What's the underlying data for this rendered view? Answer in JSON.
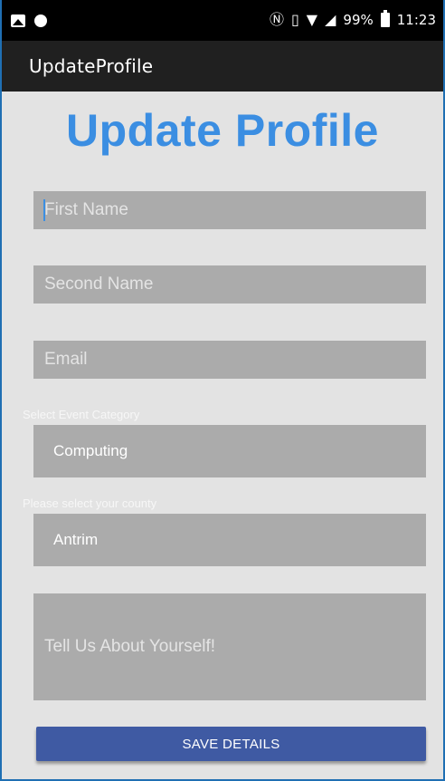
{
  "status_bar": {
    "battery_percent": "99%",
    "time": "11:23",
    "icons": [
      "image-icon",
      "record-icon",
      "nfc-icon",
      "vibrate-icon",
      "wifi-icon",
      "signal-icon",
      "battery-icon"
    ]
  },
  "app_bar": {
    "title": "UpdateProfile"
  },
  "form": {
    "heading": "Update Profile",
    "first_name_placeholder": "First Name",
    "second_name_placeholder": "Second Name",
    "email_placeholder": "Email",
    "category_label": "Select Event Category",
    "category_value": "Computing",
    "county_label": "Please select your county",
    "county_value": "Antrim",
    "about_placeholder": "Tell Us About Yourself!",
    "save_label": "SAVE DETAILS"
  },
  "colors": {
    "heading": "#3b8ee2",
    "button": "#3f5aa3",
    "field": "#ababab",
    "background": "#e3e3e3"
  }
}
